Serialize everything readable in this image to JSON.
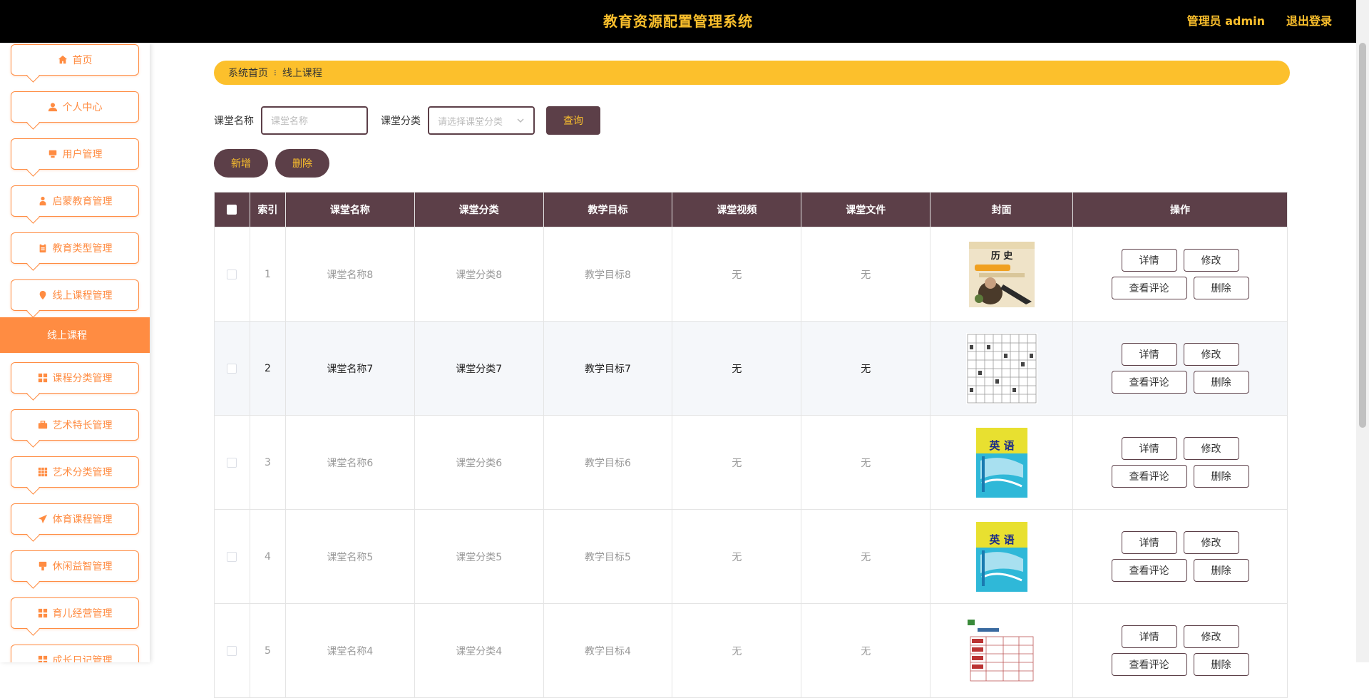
{
  "header": {
    "title": "教育资源配置管理系统",
    "admin_label": "管理员 admin",
    "logout_label": "退出登录"
  },
  "sidebar": {
    "items": [
      {
        "label": "首页",
        "icon": "home-icon"
      },
      {
        "label": "个人中心",
        "icon": "user-icon"
      },
      {
        "label": "用户管理",
        "icon": "monitor-icon"
      },
      {
        "label": "启蒙教育管理",
        "icon": "person-icon"
      },
      {
        "label": "教育类型管理",
        "icon": "clipboard-icon"
      },
      {
        "label": "线上课程管理",
        "icon": "pin-icon"
      },
      {
        "label": "课程分类管理",
        "icon": "grid-icon"
      },
      {
        "label": "艺术特长管理",
        "icon": "briefcase-icon"
      },
      {
        "label": "艺术分类管理",
        "icon": "apps-icon"
      },
      {
        "label": "体育课程管理",
        "icon": "send-icon"
      },
      {
        "label": "休闲益智管理",
        "icon": "brush-icon"
      },
      {
        "label": "育儿经营管理",
        "icon": "grid-icon"
      },
      {
        "label": "成长日记管理",
        "icon": "grid-icon"
      }
    ],
    "active_sub": "线上课程"
  },
  "breadcrumb": {
    "home": "系统首页",
    "separator": "⁝",
    "current": "线上课程"
  },
  "search": {
    "name_label": "课堂名称",
    "name_placeholder": "课堂名称",
    "category_label": "课堂分类",
    "category_placeholder": "请选择课堂分类",
    "query_label": "查询"
  },
  "actions": {
    "add_label": "新增",
    "delete_label": "删除"
  },
  "table": {
    "columns": [
      "索引",
      "课堂名称",
      "课堂分类",
      "教学目标",
      "课堂视频",
      "课堂文件",
      "封面",
      "操作"
    ],
    "rows": [
      {
        "index": "1",
        "name": "课堂名称8",
        "category": "课堂分类8",
        "goal": "教学目标8",
        "video": "无",
        "file": "无",
        "cover": "history-book"
      },
      {
        "index": "2",
        "name": "课堂名称7",
        "category": "课堂分类7",
        "goal": "教学目标7",
        "video": "无",
        "file": "无",
        "cover": "grid-sheet"
      },
      {
        "index": "3",
        "name": "课堂名称6",
        "category": "课堂分类6",
        "goal": "教学目标6",
        "video": "无",
        "file": "无",
        "cover": "english-book"
      },
      {
        "index": "4",
        "name": "课堂名称5",
        "category": "课堂分类5",
        "goal": "教学目标5",
        "video": "无",
        "file": "无",
        "cover": "english-book"
      },
      {
        "index": "5",
        "name": "课堂名称4",
        "category": "课堂分类4",
        "goal": "教学目标4",
        "video": "无",
        "file": "无",
        "cover": "table-doc"
      }
    ],
    "ops": {
      "detail": "详情",
      "edit": "修改",
      "comments": "查看评论",
      "delete": "删除"
    }
  },
  "cover_text": {
    "history": "历 史",
    "english": "英 语"
  },
  "colors": {
    "primary": "#5c3f48",
    "accent": "#fcc02c",
    "orange": "#ff8c42",
    "header_bg": "#000000"
  }
}
